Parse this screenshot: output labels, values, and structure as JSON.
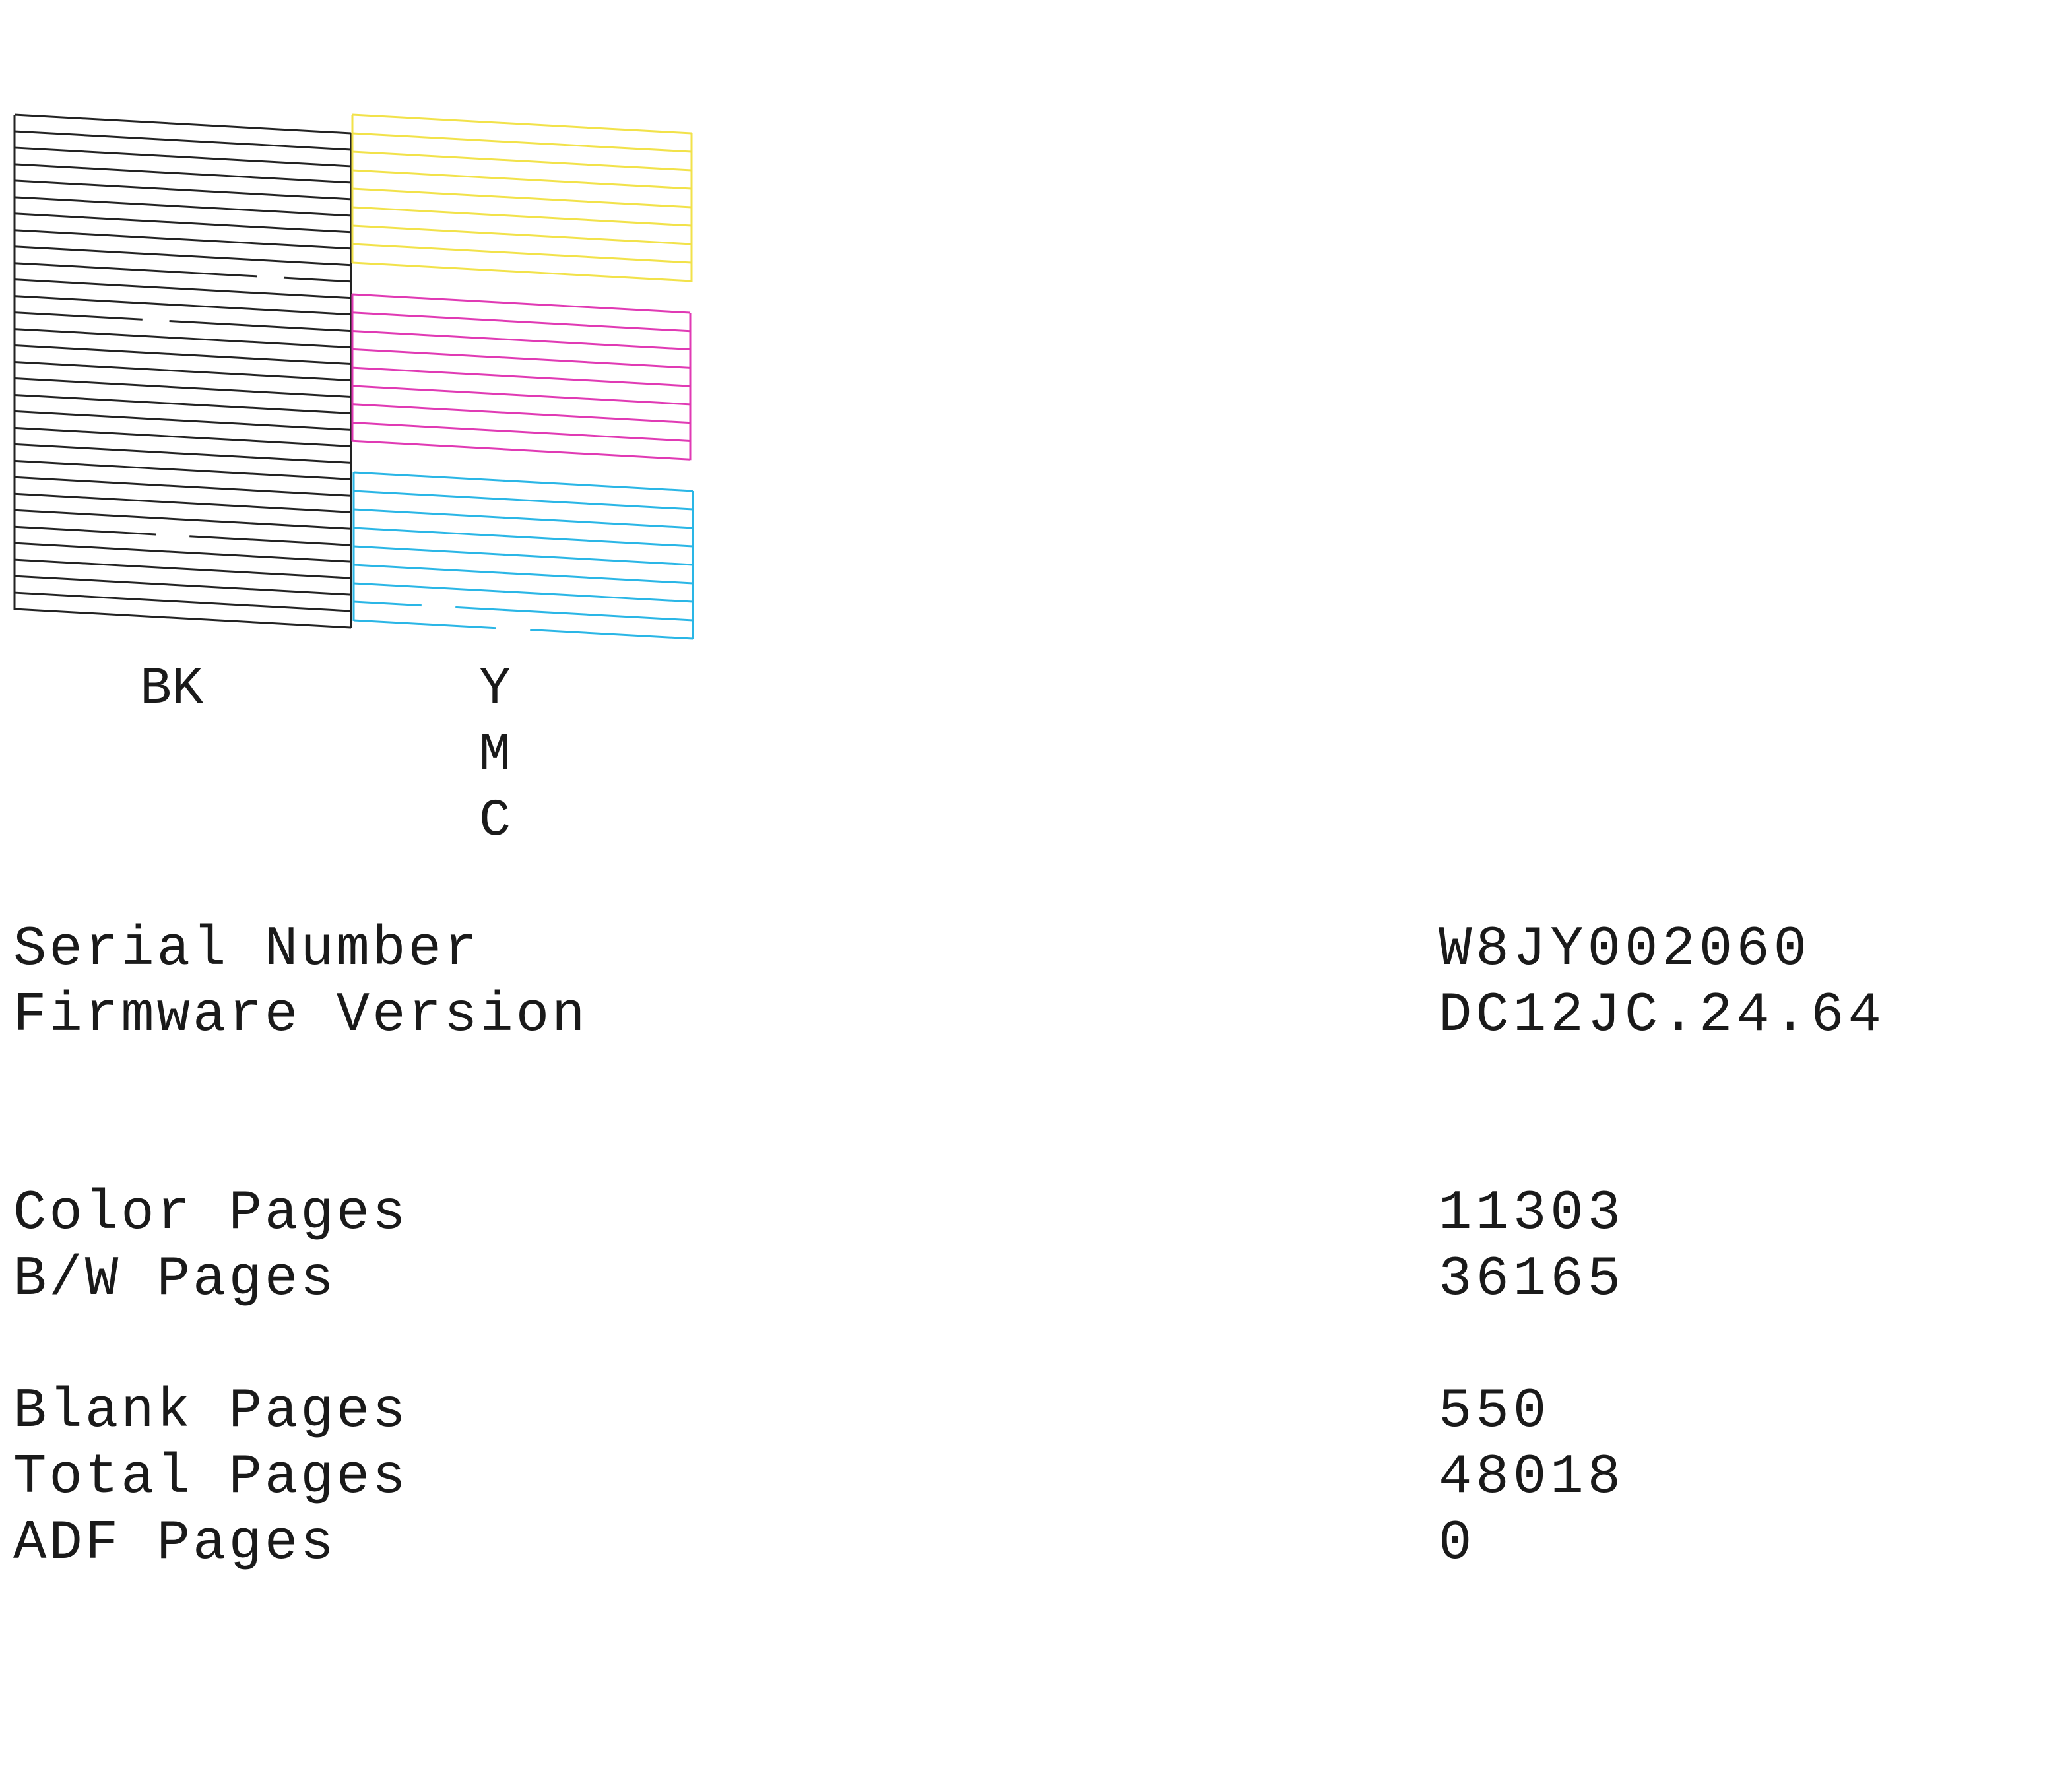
{
  "nozzle_check": {
    "labels": {
      "black": "BK",
      "yellow": "Y",
      "magenta": "M",
      "cyan": "C"
    },
    "colors": {
      "black": "#222222",
      "yellow": "#f2e24a",
      "magenta": "#e03ab4",
      "cyan": "#2ab6e6"
    }
  },
  "info": [
    {
      "label": "Serial Number",
      "value": "W8JY002060"
    },
    {
      "label": "Firmware Version",
      "value": "DC12JC.24.64"
    },
    {
      "label": "Color Pages",
      "value": "11303"
    },
    {
      "label": "B/W Pages",
      "value": "36165"
    },
    {
      "label": "Blank Pages",
      "value": "550"
    },
    {
      "label": "Total Pages",
      "value": "48018"
    },
    {
      "label": "ADF Pages",
      "value": "0"
    }
  ]
}
